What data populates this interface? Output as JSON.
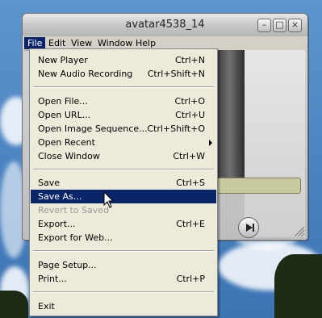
{
  "window": {
    "title": "avatar4538_14",
    "controls": [
      "minimize-icon",
      "maximize-icon",
      "close-icon"
    ]
  },
  "menubar": {
    "items": [
      "File",
      "Edit",
      "View",
      "Window",
      "Help"
    ],
    "active": "File"
  },
  "file_menu": {
    "items": [
      {
        "label": "New Player",
        "shortcut": "Ctrl+N"
      },
      {
        "label": "New Audio Recording",
        "shortcut": "Ctrl+Shift+N"
      },
      {
        "label": "Open File...",
        "shortcut": "Ctrl+O"
      },
      {
        "label": "Open URL...",
        "shortcut": "Ctrl+U"
      },
      {
        "label": "Open Image Sequence...",
        "shortcut": "Ctrl+Shift+O"
      },
      {
        "label": "Open Recent",
        "shortcut": ""
      },
      {
        "label": "Close Window",
        "shortcut": "Ctrl+W"
      },
      {
        "label": "Save",
        "shortcut": "Ctrl+S"
      },
      {
        "label": "Save As...",
        "shortcut": ""
      },
      {
        "label": "Revert to Saved",
        "shortcut": ""
      },
      {
        "label": "Export...",
        "shortcut": "Ctrl+E"
      },
      {
        "label": "Export for Web...",
        "shortcut": ""
      },
      {
        "label": "Page Setup...",
        "shortcut": ""
      },
      {
        "label": "Print...",
        "shortcut": "Ctrl+P"
      },
      {
        "label": "Exit",
        "shortcut": ""
      }
    ],
    "selected": "Save As...",
    "disabled": [
      "Revert to Saved"
    ]
  },
  "colors": {
    "selection": "#0a246a",
    "menu_bg": "#ecead9",
    "sky": "#4e86c4"
  }
}
